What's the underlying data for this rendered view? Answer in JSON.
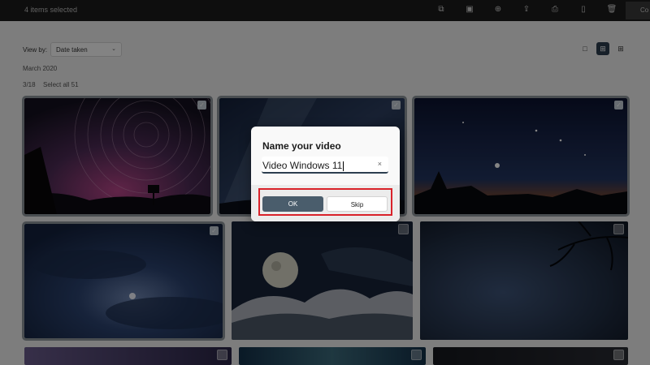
{
  "topbar": {
    "selection_text": "4 items selected",
    "truncated_button_label": "Co",
    "icons": [
      "copy-icon",
      "edit-image-icon",
      "add-icon",
      "share-icon",
      "print-icon",
      "phone-icon",
      "delete-icon"
    ]
  },
  "toolbar": {
    "view_by_label": "View by:",
    "view_by_value": "Date taken"
  },
  "gallery": {
    "month": "March 2020",
    "count": "3/18",
    "select_all": "Select all 51"
  },
  "dialog": {
    "title": "Name your video",
    "input_value": "Video Windows 11",
    "clear_icon": "×",
    "ok_label": "OK",
    "skip_label": "Skip"
  },
  "colors": {
    "accent": "#2c3e50",
    "highlight_box": "#d9222a"
  }
}
